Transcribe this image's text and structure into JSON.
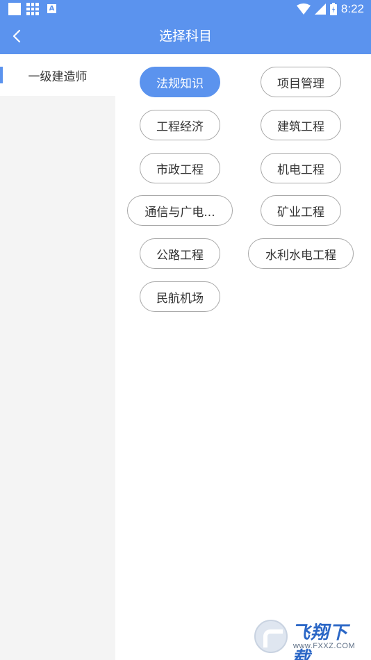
{
  "status_bar": {
    "time": "8:22",
    "a_badge": "A"
  },
  "header": {
    "title": "选择科目"
  },
  "sidebar": {
    "items": [
      {
        "label": "一级建造师",
        "selected": true
      }
    ]
  },
  "subjects": [
    {
      "label": "法规知识",
      "selected": true
    },
    {
      "label": "项目管理",
      "selected": false
    },
    {
      "label": "工程经济",
      "selected": false
    },
    {
      "label": "建筑工程",
      "selected": false
    },
    {
      "label": "市政工程",
      "selected": false
    },
    {
      "label": "机电工程",
      "selected": false
    },
    {
      "label": "通信与广电...",
      "selected": false
    },
    {
      "label": "矿业工程",
      "selected": false
    },
    {
      "label": "公路工程",
      "selected": false
    },
    {
      "label": "水利水电工程",
      "selected": false
    },
    {
      "label": "民航机场",
      "selected": false
    }
  ],
  "watermark": {
    "brand": "飞翔下载",
    "url": "www.FXXZ.COM"
  },
  "colors": {
    "accent": "#5b93ee",
    "chip_border": "#a8a8a8",
    "sidebar_bg": "#f4f4f4"
  }
}
